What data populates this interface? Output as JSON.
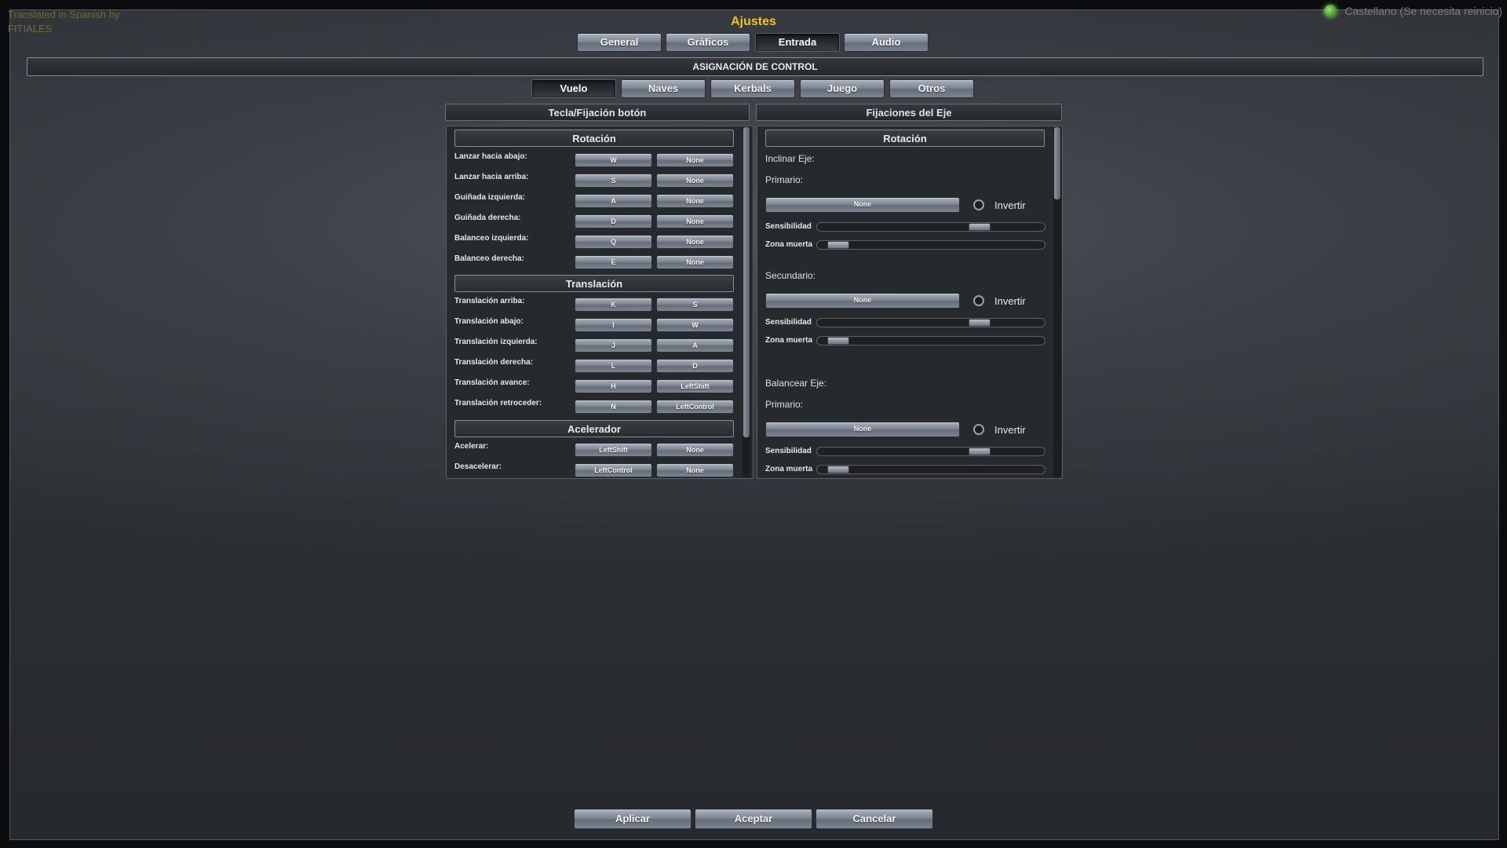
{
  "credit": {
    "line1": "Translated in Spanish by",
    "line2": "FITIALES"
  },
  "language": {
    "label": "Castellano (Se necesita reinicio)"
  },
  "title": "Ajustes",
  "tabs": [
    "General",
    "Gráficos",
    "Entrada",
    "Audio"
  ],
  "active_tab": "Entrada",
  "section_title": "ASIGNACIÓN DE CONTROL",
  "subtabs": [
    "Vuelo",
    "Naves",
    "Kerbals",
    "Juego",
    "Otros"
  ],
  "active_subtab": "Vuelo",
  "left_panel": {
    "header": "Tecla/Fijación botón",
    "groups": [
      {
        "title": "Rotación",
        "rows": [
          {
            "label": "Lanzar hacia abajo:",
            "primary": "W",
            "secondary": "None"
          },
          {
            "label": "Lanzar hacia arriba:",
            "primary": "S",
            "secondary": "None"
          },
          {
            "label": "Guiñada izquierda:",
            "primary": "A",
            "secondary": "None"
          },
          {
            "label": "Guiñada derecha:",
            "primary": "D",
            "secondary": "None"
          },
          {
            "label": "Balanceo izquierda:",
            "primary": "Q",
            "secondary": "None"
          },
          {
            "label": "Balanceo derecha:",
            "primary": "E",
            "secondary": "None"
          }
        ]
      },
      {
        "title": "Translación",
        "rows": [
          {
            "label": "Translación arriba:",
            "primary": "K",
            "secondary": "S"
          },
          {
            "label": "Translación abajo:",
            "primary": "I",
            "secondary": "W"
          },
          {
            "label": "Translación izquierda:",
            "primary": "J",
            "secondary": "A"
          },
          {
            "label": "Translación derecha:",
            "primary": "L",
            "secondary": "D"
          },
          {
            "label": "Translación avance:",
            "primary": "H",
            "secondary": "LeftShift"
          },
          {
            "label": "Translación retroceder:",
            "primary": "N",
            "secondary": "LeftControl"
          }
        ]
      },
      {
        "title": "Acelerador",
        "rows": [
          {
            "label": "Acelerar:",
            "primary": "LeftShift",
            "secondary": "None"
          },
          {
            "label": "Desacelerar:",
            "primary": "LeftControl",
            "secondary": "None"
          }
        ]
      }
    ]
  },
  "right_panel": {
    "header": "Fijaciones del Eje",
    "group_title": "Rotación",
    "axes": [
      {
        "name": "Inclinar Eje:",
        "bindings": [
          {
            "label": "Primario:",
            "value": "None",
            "invert_label": "Invertir",
            "sensitivity_label": "Sensibilidad",
            "sensitivity": 0.73,
            "deadzone_label": "Zona muerta",
            "deadzone": 0.05
          }
        ]
      },
      {
        "name": "",
        "bindings": [
          {
            "label": "Secundario:",
            "value": "None",
            "invert_label": "Invertir",
            "sensitivity_label": "Sensibilidad",
            "sensitivity": 0.73,
            "deadzone_label": "Zona muerta",
            "deadzone": 0.05
          }
        ]
      },
      {
        "name": "Balancear Eje:",
        "bindings": [
          {
            "label": "Primario:",
            "value": "None",
            "invert_label": "Invertir",
            "sensitivity_label": "Sensibilidad",
            "sensitivity": 0.73,
            "deadzone_label": "Zona muerta",
            "deadzone": 0.05
          }
        ]
      }
    ]
  },
  "footer": {
    "apply": "Aplicar",
    "accept": "Aceptar",
    "cancel": "Cancelar"
  },
  "colors": {
    "title": "#f1c21b",
    "credit": "#6e6a3b",
    "status_dot": "#6fd050"
  }
}
